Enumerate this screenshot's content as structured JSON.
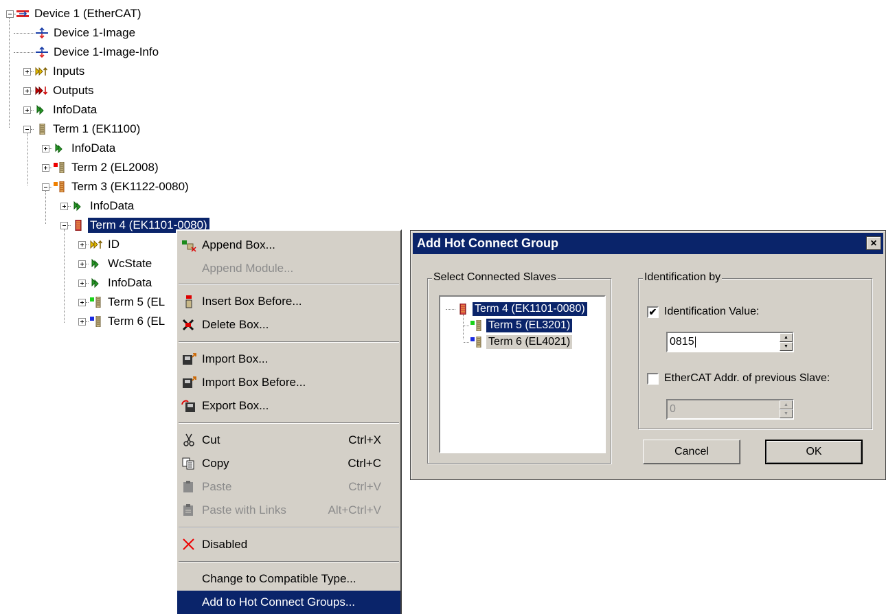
{
  "tree": {
    "nodes": [
      {
        "label": "Device 1 (EtherCAT)",
        "icon": "ethercat-device-icon"
      },
      {
        "label": "Device 1-Image",
        "icon": "image-icon"
      },
      {
        "label": "Device 1-Image-Info",
        "icon": "image-info-icon"
      },
      {
        "label": "Inputs",
        "icon": "inputs-icon"
      },
      {
        "label": "Outputs",
        "icon": "outputs-icon"
      },
      {
        "label": "InfoData",
        "icon": "infodata-icon"
      },
      {
        "label": "Term 1 (EK1100)",
        "icon": "terminal-icon"
      },
      {
        "label": "InfoData",
        "icon": "infodata-icon"
      },
      {
        "label": "Term 2 (EL2008)",
        "icon": "terminal-icon"
      },
      {
        "label": "Term 3 (EK1122-0080)",
        "icon": "terminal-icon"
      },
      {
        "label": "InfoData",
        "icon": "infodata-icon"
      },
      {
        "label": "Term 4 (EK1101-0080)",
        "icon": "terminal-icon",
        "selected": true
      },
      {
        "label": "ID",
        "icon": "inputs-icon"
      },
      {
        "label": "WcState",
        "icon": "infodata-icon"
      },
      {
        "label": "InfoData",
        "icon": "infodata-icon"
      },
      {
        "label": "Term 5 (EL",
        "icon": "terminal-icon"
      },
      {
        "label": "Term 6 (EL",
        "icon": "terminal-icon"
      }
    ]
  },
  "menu": {
    "append_box": "Append Box...",
    "append_module": "Append Module...",
    "insert_box_before": "Insert Box Before...",
    "delete_box": "Delete Box...",
    "import_box": "Import Box...",
    "import_box_before": "Import Box Before...",
    "export_box": "Export Box...",
    "cut": "Cut",
    "cut_key": "Ctrl+X",
    "copy": "Copy",
    "copy_key": "Ctrl+C",
    "paste": "Paste",
    "paste_key": "Ctrl+V",
    "paste_links": "Paste with Links",
    "paste_links_key": "Alt+Ctrl+V",
    "disabled": "Disabled",
    "change_type": "Change to Compatible Type...",
    "add_hot_connect": "Add to Hot Connect Groups..."
  },
  "dialog": {
    "title": "Add Hot Connect Group",
    "close": "×",
    "slaves_group": "Select Connected Slaves",
    "slaves": [
      "Term 4 (EK1101-0080)",
      "Term 5 (EL3201)",
      "Term 6 (EL4021)"
    ],
    "ident_group": "Identification by",
    "ident_value_label": "Identification Value:",
    "ident_value_checked": "✔",
    "ident_value": "0815",
    "prev_addr_label": "EtherCAT Addr. of previous Slave:",
    "prev_addr_value": "0",
    "cancel": "Cancel",
    "ok": "OK",
    "spin_up": "▲",
    "spin_down": "▼"
  }
}
